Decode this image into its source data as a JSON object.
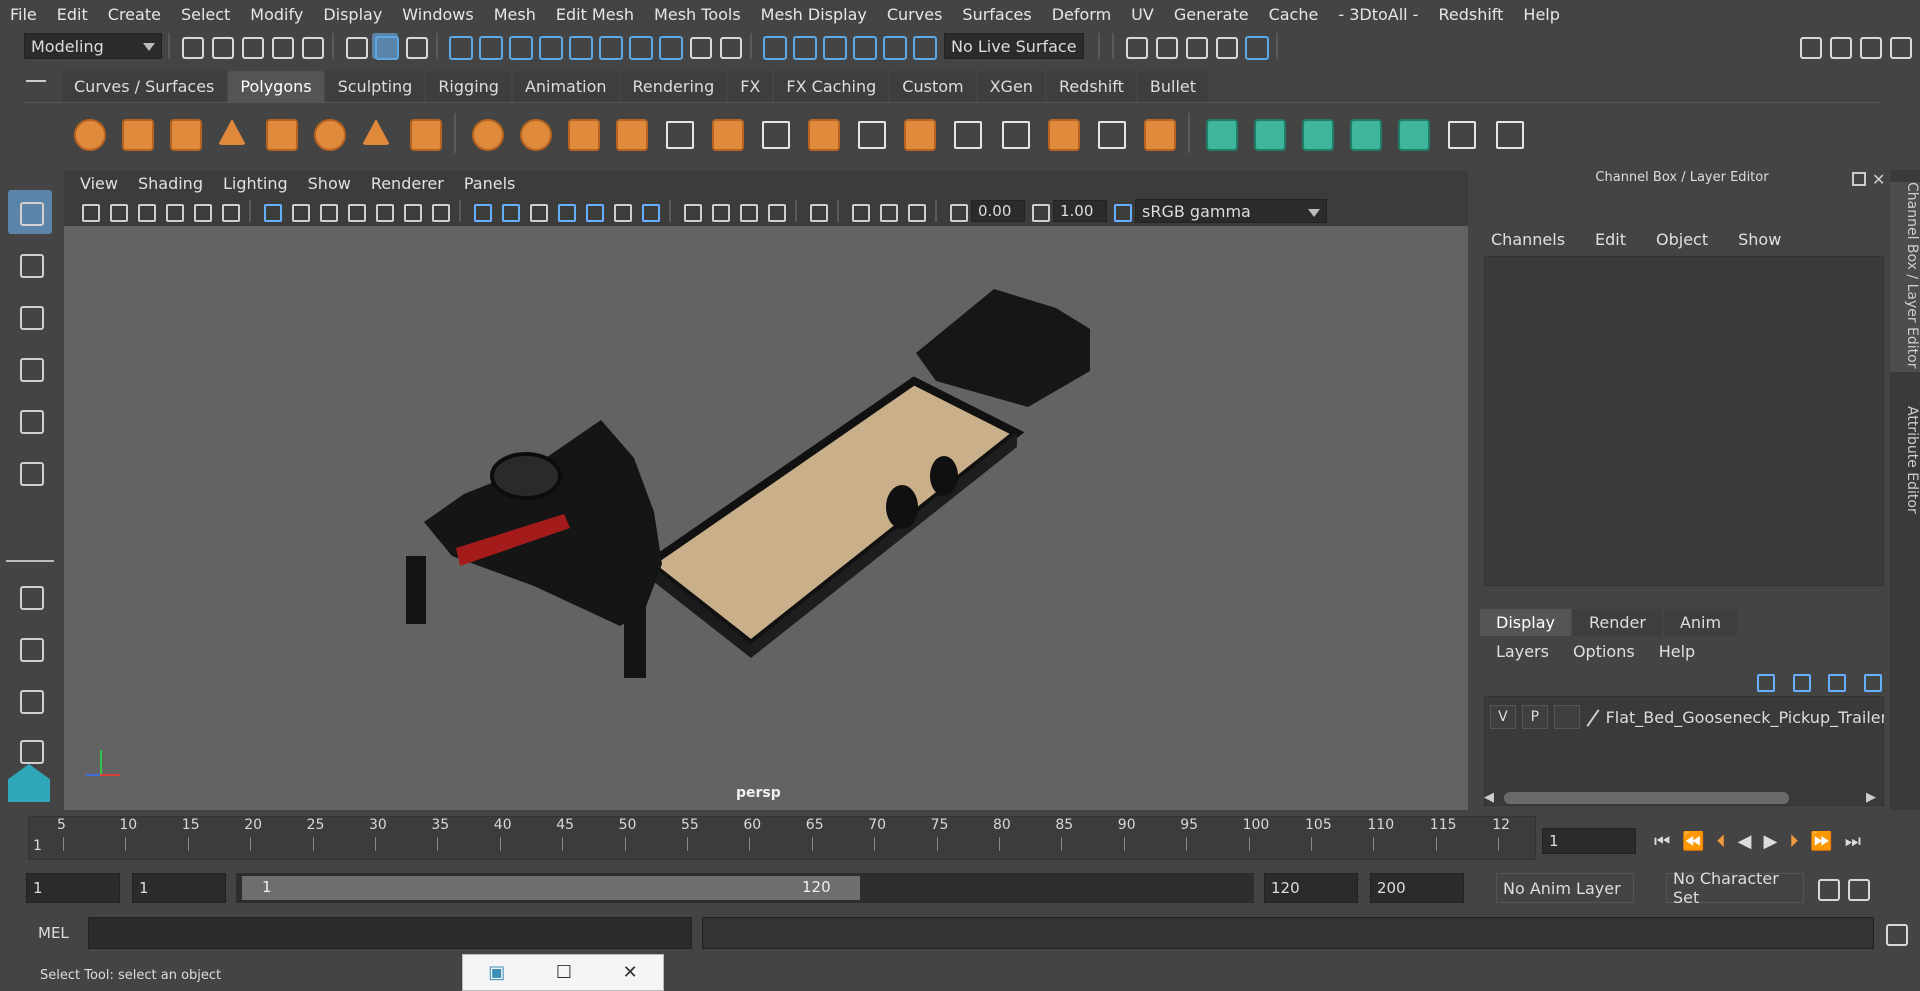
{
  "menubar": {
    "items": [
      "File",
      "Edit",
      "Create",
      "Select",
      "Modify",
      "Display",
      "Windows",
      "Mesh",
      "Edit Mesh",
      "Mesh Tools",
      "Mesh Display",
      "Curves",
      "Surfaces",
      "Deform",
      "UV",
      "Generate",
      "Cache",
      "- 3DtoAll -",
      "Redshift",
      "Help"
    ]
  },
  "status": {
    "mode": "Modeling",
    "live_surface": "No Live Surface"
  },
  "shelf": {
    "tabs": [
      "Curves / Surfaces",
      "Polygons",
      "Sculpting",
      "Rigging",
      "Animation",
      "Rendering",
      "FX",
      "FX Caching",
      "Custom",
      "XGen",
      "Redshift",
      "Bullet"
    ],
    "active": "Polygons"
  },
  "viewport": {
    "menus": [
      "View",
      "Shading",
      "Lighting",
      "Show",
      "Renderer",
      "Panels"
    ],
    "exposure": "0.00",
    "gamma": "1.00",
    "colorspace": "sRGB gamma",
    "camera_label": "persp"
  },
  "panel": {
    "title": "Channel Box / Layer Editor",
    "channel_menu": [
      "Channels",
      "Edit",
      "Object",
      "Show"
    ],
    "layer_tabs": [
      "Display",
      "Render",
      "Anim"
    ],
    "layer_menu": [
      "Layers",
      "Options",
      "Help"
    ],
    "layer": {
      "v": "V",
      "p": "P",
      "name": "Flat_Bed_Gooseneck_Pickup_Trailer_C"
    },
    "side_tabs": [
      "Channel Box / Layer Editor",
      "Attribute Editor"
    ]
  },
  "timeline": {
    "ticks": [
      "5",
      "10",
      "15",
      "20",
      "25",
      "30",
      "35",
      "40",
      "45",
      "50",
      "55",
      "60",
      "65",
      "70",
      "75",
      "80",
      "85",
      "90",
      "95",
      "100",
      "105",
      "110",
      "115",
      "12"
    ],
    "start_label": "1",
    "current_frame": "1"
  },
  "range": {
    "start": "1",
    "playback_start": "1",
    "slider_start": "1",
    "slider_end": "120",
    "playback_end": "120",
    "end": "200",
    "anim_layer": "No Anim Layer",
    "char_set": "No Character Set"
  },
  "cmd": {
    "label": "MEL"
  },
  "help": {
    "text": "Select Tool: select an object"
  },
  "colors": {
    "accent_blue": "#5c84a8",
    "shelf_orange": "#e08a3c",
    "shelf_teal": "#3fb59c"
  }
}
